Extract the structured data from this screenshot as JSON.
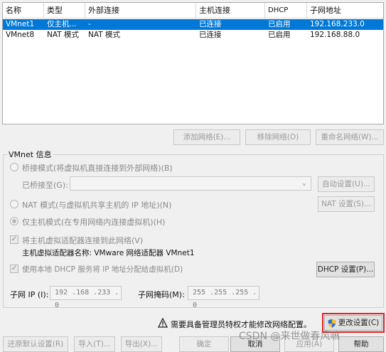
{
  "table": {
    "headers": [
      "名称",
      "类型",
      "外部连接",
      "主机连接",
      "DHCP",
      "子网地址"
    ],
    "rows": [
      {
        "name": "VMnet1",
        "type": "仅主机...",
        "external": "-",
        "host": "已连接",
        "dhcp": "已启用",
        "subnet": "192.168.233.0",
        "selected": true
      },
      {
        "name": "VMnet8",
        "type": "NAT 模式",
        "external": "NAT 模式",
        "host": "已连接",
        "dhcp": "已启用",
        "subnet": "192.168.88.0",
        "selected": false
      }
    ]
  },
  "list_buttons": {
    "add": "添加网络(E)...",
    "remove": "移除网络(O)",
    "rename": "重命名网络(W)..."
  },
  "info": {
    "title": "VMnet 信息",
    "bridge_radio": "桥接模式(将虚拟机直接连接到外部网络)(B)",
    "bridged_to_label": "已桥接至(G):",
    "auto_settings": "自动设置(U)...",
    "nat_radio": "NAT 模式(与虚拟机共享主机的 IP 地址)(N)",
    "nat_settings": "NAT 设置(S)...",
    "hostonly_radio": "仅主机模式(在专用网络内连接虚拟机)(H)",
    "connect_adapter": "将主机虚拟适配器连接到此网络(V)",
    "adapter_name": "主机虚拟适配器名称: VMware 网络适配器 VMnet1",
    "use_dhcp": "使用本地 DHCP 服务将 IP 地址分配给虚拟机(D)",
    "dhcp_settings": "DHCP 设置(P)...",
    "subnet_ip_label": "子网 IP (I):",
    "subnet_ip": "192 .168 .233 .  0",
    "subnet_mask_label": "子网掩码(M):",
    "subnet_mask": "255 .255 .255 .  0"
  },
  "admin": {
    "warning_icon": "warning-icon",
    "message": "需要具备管理员特权才能修改网络配置。",
    "change_settings": "更改设置(C)"
  },
  "footer": {
    "restore": "还原默认设置(R)",
    "import": "导入(T)...",
    "export": "导出(X)...",
    "ok": "确定",
    "cancel": "取消",
    "apply": "应用(A)",
    "help": "帮助"
  },
  "watermark": "CSDN @来世做春风嘛"
}
